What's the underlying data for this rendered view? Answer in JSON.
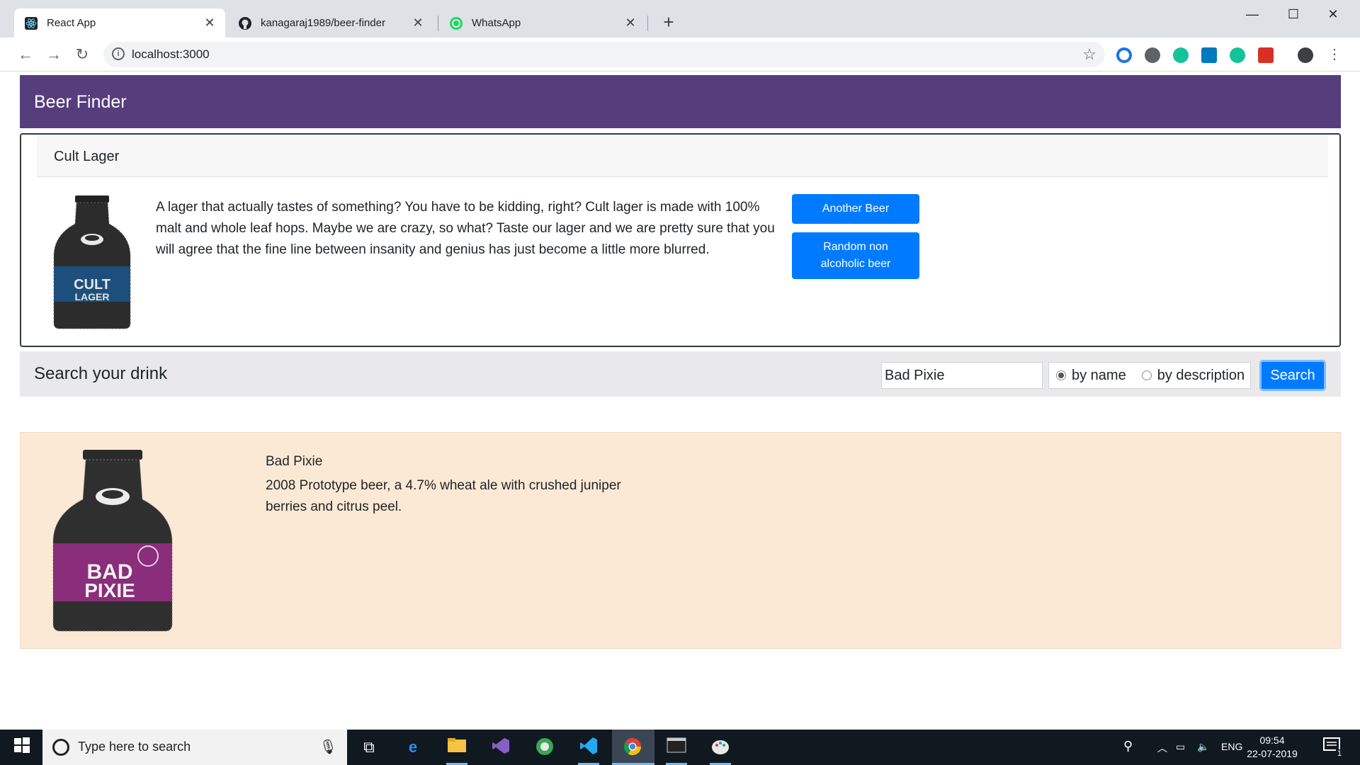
{
  "browser": {
    "tabs": [
      {
        "title": "React App"
      },
      {
        "title": "kanagaraj1989/beer-finder"
      },
      {
        "title": "WhatsApp"
      }
    ],
    "url": "localhost:3000"
  },
  "app": {
    "brand": "Beer Finder",
    "featured": {
      "name": "Cult Lager",
      "description": "A lager that actually tastes of something? You have to be kidding, right? Cult lager is made with 100% malt and whole leaf hops. Maybe we are crazy, so what? Taste our lager and we are pretty sure that you will agree that the fine line between insanity and genius has just become a little more blurred.",
      "another_button": "Another Beer",
      "non_alcoholic_button": "Random non alcoholic beer",
      "label_text": "CULT LAGER",
      "label_color": "#1d4f7c"
    },
    "search": {
      "label": "Search your drink",
      "query": "Bad Pixie",
      "option_name": "by name",
      "option_description": "by description",
      "selected": "by name",
      "button": "Search"
    },
    "result": {
      "name": "Bad Pixie",
      "description": "2008 Prototype beer, a 4.7% wheat ale with crushed juniper berries and citrus peel.",
      "label_text": "BAD PIXIE",
      "label_color": "#8a2d7a"
    }
  },
  "taskbar": {
    "search_placeholder": "Type here to search",
    "language": "ENG",
    "time": "09:54",
    "date": "22-07-2019",
    "notification_count": "1"
  }
}
